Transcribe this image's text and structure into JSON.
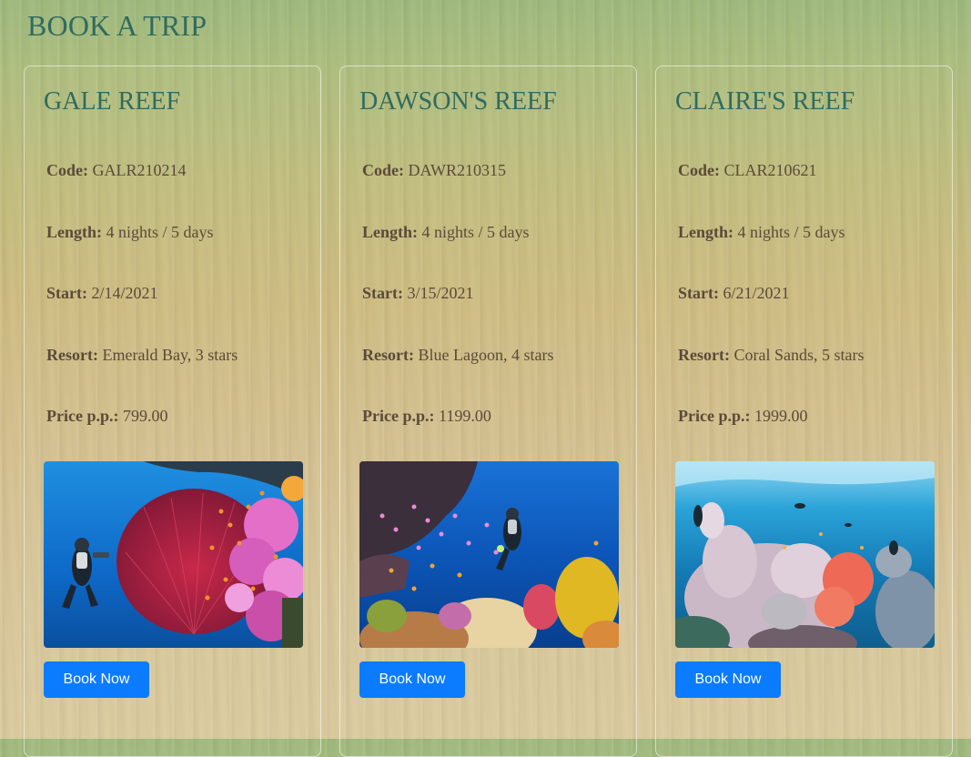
{
  "page": {
    "title": "BOOK A TRIP"
  },
  "labels": {
    "code": "Code:",
    "length": "Length:",
    "start": "Start:",
    "resort": "Resort:",
    "price": "Price p.p.:"
  },
  "trips": [
    {
      "name": "GALE REEF",
      "code": "GALR210214",
      "length": "4 nights / 5 days",
      "start": "2/14/2021",
      "resort": "Emerald Bay, 3 stars",
      "price": "799.00",
      "button": "Book Now"
    },
    {
      "name": "DAWSON'S REEF",
      "code": "DAWR210315",
      "length": "4 nights / 5 days",
      "start": "3/15/2021",
      "resort": "Blue Lagoon, 4 stars",
      "price": "1199.00",
      "button": "Book Now"
    },
    {
      "name": "CLAIRE'S REEF",
      "code": "CLAR210621",
      "length": "4 nights / 5 days",
      "start": "6/21/2021",
      "resort": "Coral Sands, 5 stars",
      "price": "1999.00",
      "button": "Book Now"
    }
  ],
  "colors": {
    "heading": "#2f6b5f",
    "text": "#5b4a39",
    "button": "#0b7bff",
    "button_text": "#ffffff"
  }
}
